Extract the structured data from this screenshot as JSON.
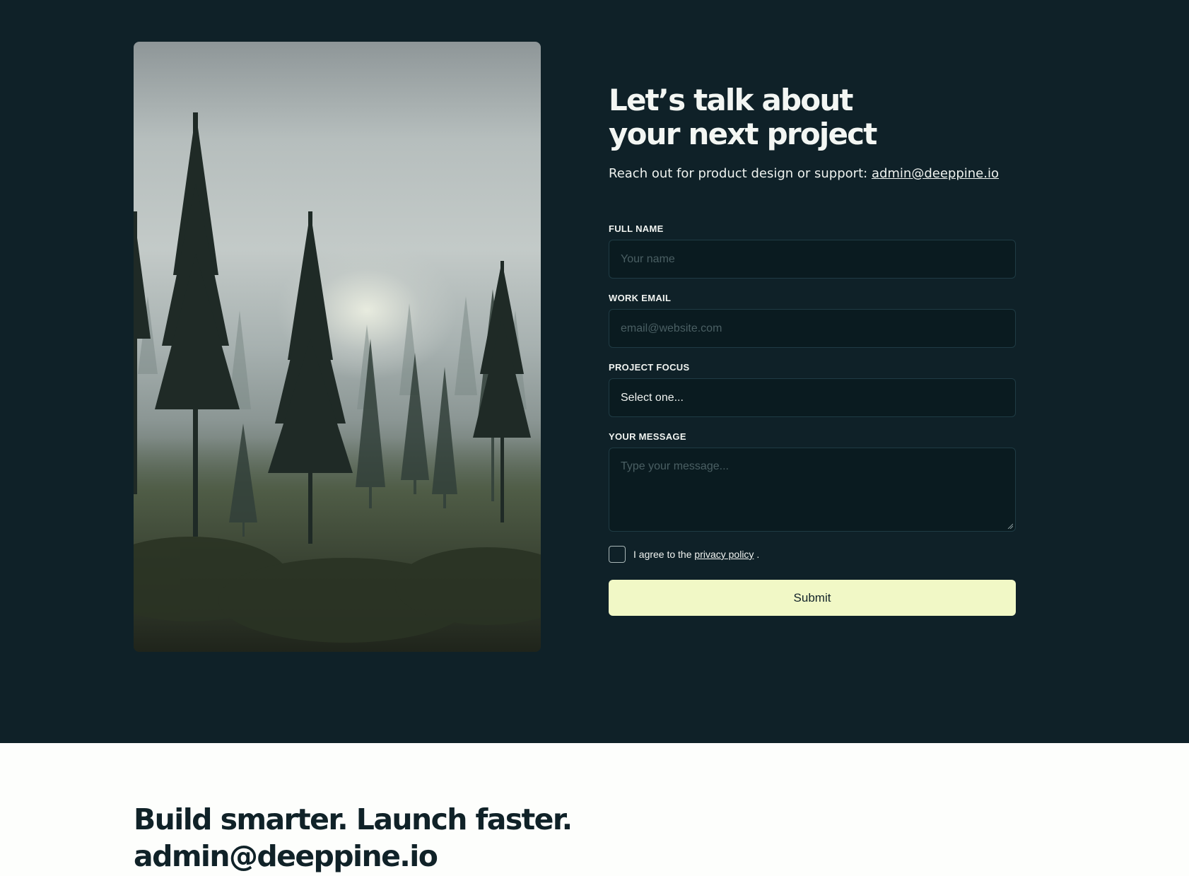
{
  "hero": {
    "headline_line1": "Let’s talk about",
    "headline_line2": "your next project",
    "subline_prefix": "Reach out for product design or support:",
    "email": "admin@deeppine.io"
  },
  "form": {
    "name_label": "FULL NAME",
    "name_placeholder": "Your name",
    "email_label": "WORK EMAIL",
    "email_placeholder": "email@website.com",
    "focus_label": "PROJECT FOCUS",
    "focus_value": "Select one...",
    "message_label": "YOUR MESSAGE",
    "message_placeholder": "Type your message...",
    "agree_prefix": "I agree to the",
    "agree_link": "privacy policy",
    "agree_suffix": ".",
    "agree_checked": false,
    "submit_label": "Submit"
  },
  "footer": {
    "tagline": "Build smarter. Launch faster.",
    "email": "admin@deeppine.io"
  },
  "colors": {
    "background": "#0f2128",
    "input_bg": "#0a1b20",
    "submit_bg": "#f1f8c6",
    "footer_bg": "#fdfefc"
  },
  "icons": {
    "image": "misty-forest-photo",
    "resize": "textarea-resize-icon"
  }
}
